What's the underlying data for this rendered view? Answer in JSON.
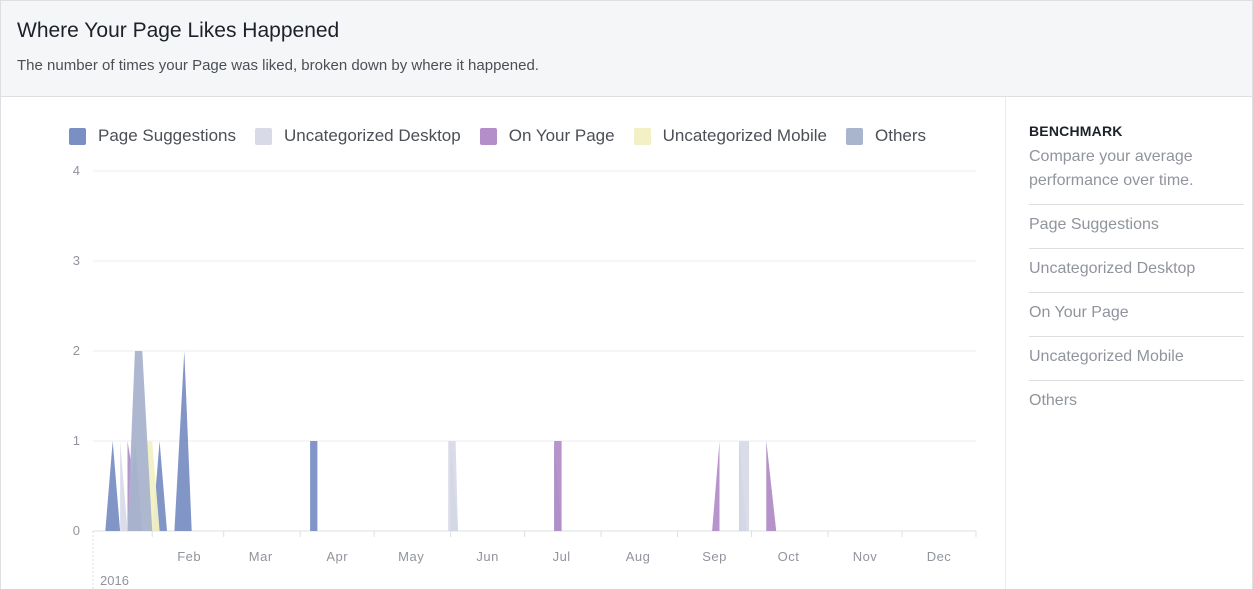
{
  "header": {
    "title": "Where Your Page Likes Happened",
    "subtitle": "The number of times your Page was liked, broken down by where it happened."
  },
  "benchmark": {
    "title": "BENCHMARK",
    "description": "Compare your average performance over time.",
    "items": [
      "Page Suggestions",
      "Uncategorized Desktop",
      "On Your Page",
      "Uncategorized Mobile",
      "Others"
    ]
  },
  "chart_data": {
    "type": "area",
    "xlabel": "",
    "ylabel": "",
    "ylim": [
      0,
      4
    ],
    "yticks": [
      0,
      1,
      2,
      3,
      4
    ],
    "x_axis": {
      "range": [
        "2016-01-08",
        "2016-12-31"
      ],
      "month_labels": [
        "Feb",
        "Mar",
        "Apr",
        "May",
        "Jun",
        "Jul",
        "Aug",
        "Sep",
        "Oct",
        "Nov",
        "Dec"
      ],
      "year_label": "2016"
    },
    "grid": true,
    "legend_position": "top",
    "series": [
      {
        "name": "Page Suggestions",
        "color": "#7a8fc4",
        "points": [
          [
            "2016-01-13",
            0
          ],
          [
            "2016-01-16",
            1
          ],
          [
            "2016-01-19",
            0
          ],
          [
            "2016-01-22",
            0
          ],
          [
            "2016-01-25",
            1
          ],
          [
            "2016-01-28",
            0
          ],
          [
            "2016-02-01",
            0
          ],
          [
            "2016-02-04",
            1
          ],
          [
            "2016-02-07",
            0
          ],
          [
            "2016-02-10",
            0
          ],
          [
            "2016-02-14",
            2
          ],
          [
            "2016-02-17",
            0
          ],
          [
            "2016-04-05",
            0
          ],
          [
            "2016-04-05",
            1
          ],
          [
            "2016-04-08",
            1
          ],
          [
            "2016-04-08",
            0
          ],
          [
            "2016-06-01",
            0
          ],
          [
            "2016-06-01",
            1
          ],
          [
            "2016-06-04",
            0
          ],
          [
            "2016-07-13",
            0
          ],
          [
            "2016-07-13",
            1
          ],
          [
            "2016-07-16",
            0
          ],
          [
            "2016-09-26",
            0
          ],
          [
            "2016-09-26",
            1
          ],
          [
            "2016-09-29",
            0
          ]
        ]
      },
      {
        "name": "Uncategorized Desktop",
        "color": "#d8dae8",
        "points": [
          [
            "2016-01-19",
            0
          ],
          [
            "2016-01-19",
            1
          ],
          [
            "2016-01-22",
            0
          ],
          [
            "2016-05-31",
            0
          ],
          [
            "2016-05-31",
            1
          ],
          [
            "2016-06-03",
            1
          ],
          [
            "2016-06-04",
            0
          ],
          [
            "2016-09-26",
            0
          ],
          [
            "2016-09-26",
            1
          ],
          [
            "2016-09-30",
            1
          ],
          [
            "2016-09-30",
            0
          ],
          [
            "2016-10-07",
            0
          ],
          [
            "2016-10-07",
            1
          ],
          [
            "2016-10-11",
            0
          ]
        ]
      },
      {
        "name": "On Your Page",
        "color": "#b38ec8",
        "points": [
          [
            "2016-01-22",
            0
          ],
          [
            "2016-01-22",
            1
          ],
          [
            "2016-01-28",
            0
          ],
          [
            "2016-07-13",
            0
          ],
          [
            "2016-07-13",
            1
          ],
          [
            "2016-07-16",
            1
          ],
          [
            "2016-07-16",
            0
          ],
          [
            "2016-09-15",
            0
          ],
          [
            "2016-09-18",
            1
          ],
          [
            "2016-09-18",
            0
          ],
          [
            "2016-10-07",
            0
          ],
          [
            "2016-10-07",
            1
          ],
          [
            "2016-10-11",
            0
          ]
        ]
      },
      {
        "name": "Uncategorized Mobile",
        "color": "#f2f0c4",
        "points": [
          [
            "2016-01-29",
            0
          ],
          [
            "2016-01-29",
            1
          ],
          [
            "2016-02-01",
            1
          ],
          [
            "2016-02-04",
            0
          ]
        ]
      },
      {
        "name": "Others",
        "color": "#a9b4cd",
        "points": [
          [
            "2016-01-22",
            0
          ],
          [
            "2016-01-25",
            2
          ],
          [
            "2016-01-28",
            2
          ],
          [
            "2016-02-01",
            0
          ]
        ]
      }
    ]
  }
}
